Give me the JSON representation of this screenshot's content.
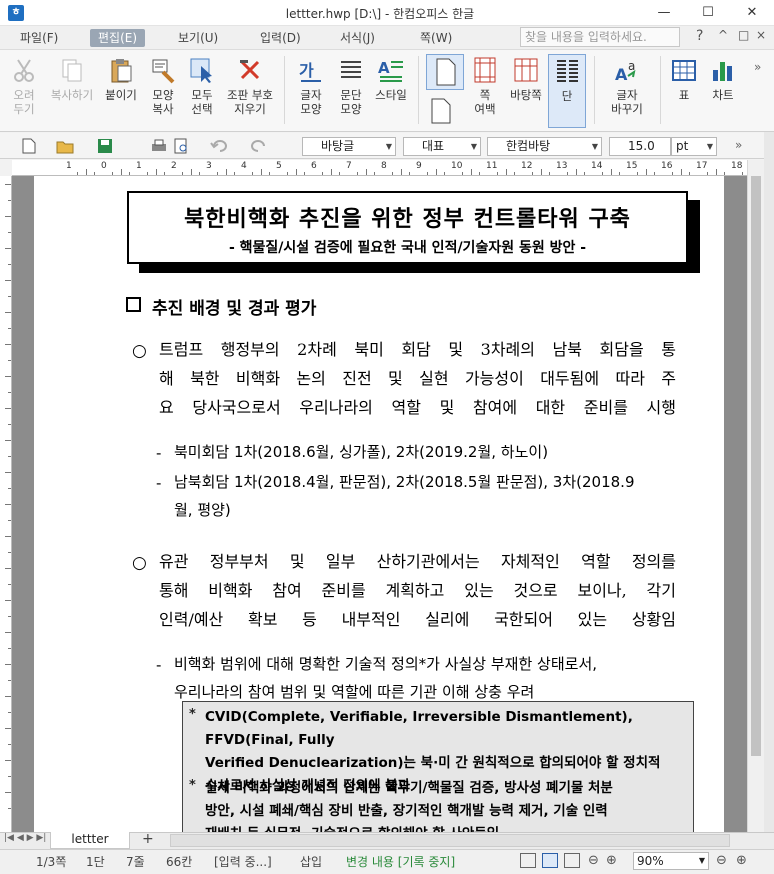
{
  "window": {
    "title": "lettter.hwp [D:\\] - 한컴오피스 한글",
    "minimize": "—",
    "maximize": "☐",
    "close": "✕"
  },
  "menu": {
    "items": [
      "파일(F)",
      "편집(E)",
      "보기(U)",
      "입력(D)",
      "서식(J)",
      "쪽(W)"
    ],
    "active_index": 1,
    "search_placeholder": "찾을 내용을 입력하세요."
  },
  "ribbon": {
    "cut": "오려\n두기",
    "copy": "복사하기",
    "paste": "붙이기",
    "format_copy": "모양\n복사",
    "select_all": "모두\n선택",
    "clear_format": "조판 부호\n지우기",
    "char_shape": "글자\n모양",
    "para_shape": "문단\n모양",
    "style": "스타일",
    "page_margin": "쪽\n여백",
    "page_border": "바탕쪽",
    "columns": "단",
    "char_replace": "글자\n바꾸기",
    "table": "표",
    "chart": "차트"
  },
  "toolbar": {
    "style_value": "바탕글",
    "font_lang": "대표",
    "font_name": "한컴바탕",
    "font_size": "15.0",
    "font_unit": "pt"
  },
  "ruler_numbers": [
    "1",
    "0",
    "1",
    "2",
    "3",
    "4",
    "5",
    "6",
    "7",
    "8",
    "9",
    "10",
    "11",
    "12",
    "13",
    "14",
    "15",
    "16",
    "17",
    "18"
  ],
  "document": {
    "title": "북한비핵화 추진을 위한 정부 컨트롤타워 구축",
    "subtitle": "- 핵물질/시설 검증에 필요한 국내 인적/기술자원 동원 방안 -",
    "section_title": "추진 배경 및 경과 평가",
    "p1_lines": [
      "트럼프 행정부의 2차례 북미 회담 및 3차례의 남북 회담을 통",
      "해 북한 비핵화 논의 진전 및 실현 가능성이 대두됨에 따라 주",
      "요 당사국으로서 우리나라의 역할 및 참여에 대한 준비를 시행"
    ],
    "p1_sub1": "북미회담 1차(2018.6월, 싱가폴), 2차(2019.2월, 하노이)",
    "p1_sub2_l1": "남북회담 1차(2018.4월, 판문점), 2차(2018.5월 판문점), 3차(2018.9",
    "p1_sub2_l2": "월, 평양)",
    "p2_lines": [
      "유관 정부부처 및 일부 산하기관에서는 자체적인 역할 정의를",
      "통해 비핵화 참여 준비를 계획하고 있는 것으로 보이나, 각기",
      "인력/예산 확보 등 내부적인 실리에 국한되어 있는 상황임"
    ],
    "p2_sub1_l1": "비핵화 범위에 대해 명확한 기술적 정의*가 사실상 부재한 상태로서,",
    "p2_sub1_l2": "우리나라의 참여 범위 및 역할에 따른 기관 이해 상충 우려",
    "note1_lines": [
      "CVID(Complete, Verifiable, Irreversible Dismantlement), FFVD(Final, Fully",
      "Verified Denuclearization)는 북·미 간 원칙적으로 합의되어야 할 정치적",
      "수사로서 사실상 개념적 정의에 불과"
    ],
    "note2_lines": [
      "실제 비핵화 과정에서의 난제는 핵무기/핵물질 검증, 방사성 폐기물 처분",
      "방안, 시설 폐쇄/핵심 장비 반출, 장기적인 핵개발 능력 제거, 기술 인력",
      "재배치 등 실무적, 기술적으로 합의해야 할 사안들임"
    ]
  },
  "tabs": {
    "doc_tab": "lettter",
    "add": "+"
  },
  "status": {
    "page": "1/3쪽",
    "column": "1단",
    "line": "7줄",
    "col": "66칸",
    "mode": "[입력 중...]",
    "insert": "삽입",
    "track": "변경 내용 [기록 중지]",
    "zoom": "90%"
  }
}
